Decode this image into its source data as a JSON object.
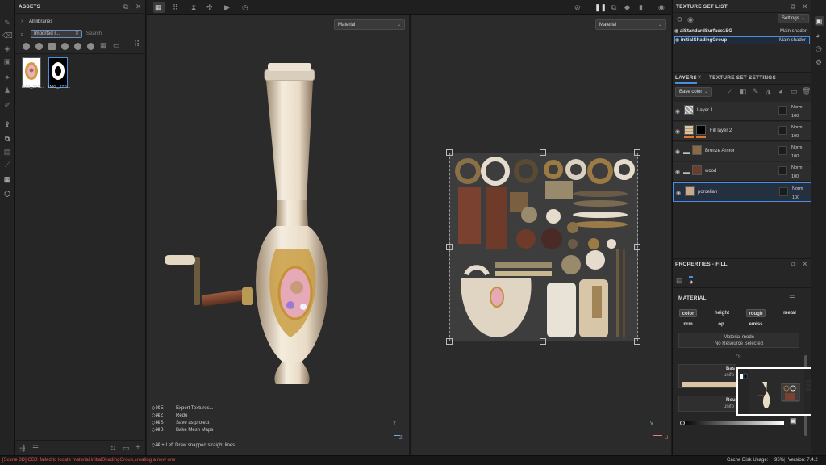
{
  "left_toolbar": {
    "tools": [
      "paint-brush-icon",
      "eraser-icon",
      "projection-icon",
      "stamp-icon",
      "smudge-icon",
      "clone-icon",
      "picker-icon",
      "export-icon",
      "bake-icon",
      "polyfill-icon",
      "fill-icon",
      "layer-icon",
      "settings-icon"
    ]
  },
  "assets": {
    "title": "ASSETS",
    "all_libraries": "All libraries",
    "filter_chip": "Imported r...",
    "search_placeholder": "Search",
    "thumbs": [
      {
        "label": "IMG_270..."
      },
      {
        "label": "IMG_270..."
      }
    ]
  },
  "viewport": {
    "left_dropdown": "Material",
    "right_dropdown": "Material",
    "shortcuts": [
      {
        "keys": "◇⌘E",
        "action": "Export Textures..."
      },
      {
        "keys": "◇⌘Z",
        "action": "Redo"
      },
      {
        "keys": "◇⌘S",
        "action": "Save as project"
      },
      {
        "keys": "◇⌘B",
        "action": "Bake Mesh Maps"
      }
    ],
    "hint": "◇⌘ + Left  Draw snapped straight lines",
    "axis_y": "Y",
    "axis_z": "Z",
    "axis_v": "V",
    "axis_u": "U"
  },
  "texture_set_list": {
    "title": "TEXTURE SET LIST",
    "settings": "Settings",
    "rows": [
      {
        "name": "aiStandardSurface1SG",
        "shader": "Main shader"
      },
      {
        "name": "initialShadingGroup",
        "shader": "Main shader"
      }
    ]
  },
  "layers": {
    "tab_layers": "LAYERS",
    "tab_settings": "TEXTURE SET SETTINGS",
    "channel": "Base color",
    "items": [
      {
        "name": "Layer 1",
        "blend": "Norm",
        "opacity": "100",
        "swatch": "#e6e6e6"
      },
      {
        "name": "Fill layer 2",
        "blend": "Norm",
        "opacity": "100",
        "swatch": "#d8c6a8"
      },
      {
        "name": "Bronze Armor",
        "blend": "Norm",
        "opacity": "100",
        "swatch": "#8a6a44"
      },
      {
        "name": "wood",
        "blend": "Norm",
        "opacity": "100",
        "swatch": "#6b3e2c"
      },
      {
        "name": "porcelian",
        "blend": "Norm",
        "opacity": "100",
        "swatch": "#c8a98c"
      }
    ]
  },
  "properties": {
    "title": "PROPERTIES - FILL",
    "section": "MATERIAL",
    "channels": [
      "color",
      "height",
      "rough",
      "metal",
      "nrm",
      "op",
      "emiss"
    ],
    "material_mode_label": "Material mode",
    "material_mode_value": "No Resource Selected",
    "or": "Or",
    "base_label": "Bas",
    "base_sub": "unifo",
    "rough_label": "Rou",
    "rough_sub": "unifo"
  },
  "status": {
    "error": "[Scene 3D] OBJ: failed to locate material initialShadingGroup,creating a new one",
    "cache_label": "Cache Disk Usage:",
    "cache_value": "95%",
    "version": "Version: 7.4.2"
  },
  "colors": {
    "accent": "#4a8fe0",
    "error": "#e0574a",
    "panel": "#262626"
  }
}
